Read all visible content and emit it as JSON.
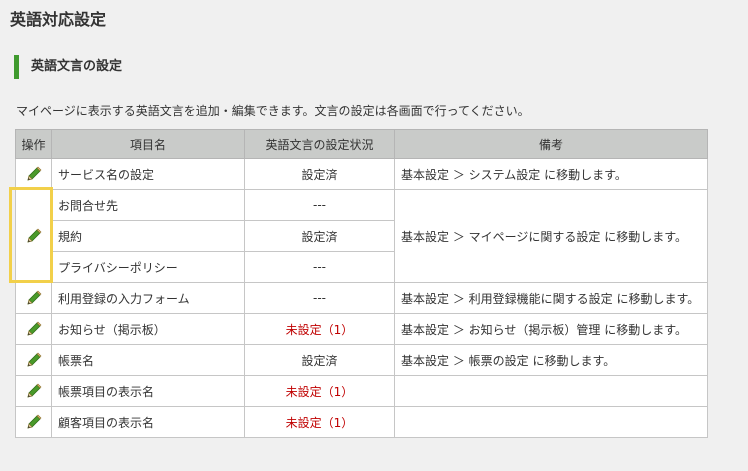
{
  "page": {
    "title": "英語対応設定"
  },
  "section": {
    "title": "英語文言の設定"
  },
  "description": "マイページに表示する英語文言を追加・編集できます。文言の設定は各画面で行ってください。",
  "table": {
    "headers": {
      "op": "操作",
      "item": "項目名",
      "status": "英語文言の設定状況",
      "note": "備考"
    },
    "rows": [
      {
        "item": "サービス名の設定",
        "status": "設定済",
        "unset": false,
        "note": "基本設定 ＞ システム設定 に移動します。"
      },
      {
        "item": "お問合せ先",
        "status": "---",
        "unset": false,
        "note": "基本設定 ＞ マイページに関する設定 に移動します。"
      },
      {
        "item": "規約",
        "status": "設定済",
        "unset": false
      },
      {
        "item": "プライバシーポリシー",
        "status": "---",
        "unset": false
      },
      {
        "item": "利用登録の入力フォーム",
        "status": "---",
        "unset": false,
        "note": "基本設定 ＞ 利用登録機能に関する設定 に移動します。"
      },
      {
        "item": "お知らせ（掲示板）",
        "status": "未設定（1）",
        "unset": true,
        "note": "基本設定 ＞ お知らせ（掲示板）管理 に移動します。"
      },
      {
        "item": "帳票名",
        "status": "設定済",
        "unset": false,
        "note": "基本設定 ＞ 帳票の設定 に移動します。"
      },
      {
        "item": "帳票項目の表示名",
        "status": "未設定（1）",
        "unset": true,
        "note": ""
      },
      {
        "item": "顧客項目の表示名",
        "status": "未設定（1）",
        "unset": true,
        "note": ""
      }
    ]
  },
  "icons": {
    "edit": "pencil-icon"
  },
  "colors": {
    "accent": "#3f9a2e",
    "unset_text": "#c00000",
    "highlight": "#f2d04a",
    "header_bg": "#c9cbc9"
  }
}
